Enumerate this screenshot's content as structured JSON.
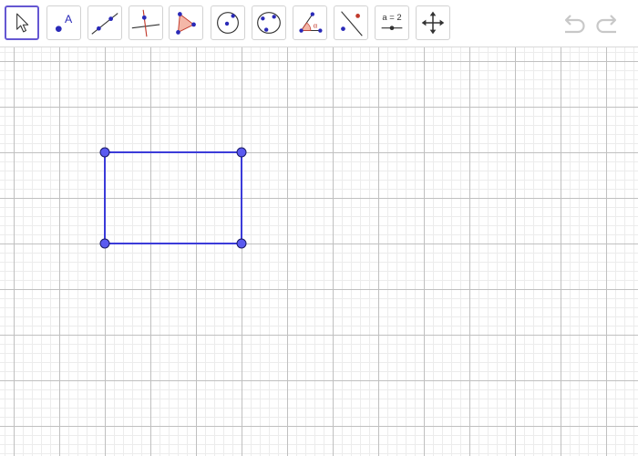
{
  "toolbar": {
    "tools": [
      {
        "id": "move",
        "icon": "move-cursor-icon",
        "selected": true
      },
      {
        "id": "point",
        "icon": "point-icon",
        "label": "A"
      },
      {
        "id": "line",
        "icon": "line-through-two-points-icon"
      },
      {
        "id": "perpendicular",
        "icon": "perpendicular-line-icon"
      },
      {
        "id": "polygon",
        "icon": "polygon-icon"
      },
      {
        "id": "circle",
        "icon": "circle-center-point-icon"
      },
      {
        "id": "conic",
        "icon": "circle-through-three-points-icon"
      },
      {
        "id": "angle",
        "icon": "angle-icon",
        "label": "α"
      },
      {
        "id": "reflect",
        "icon": "reflect-about-line-icon"
      },
      {
        "id": "slider",
        "icon": "slider-icon",
        "label": "a = 2"
      },
      {
        "id": "move-graphics",
        "icon": "move-graphics-view-icon"
      }
    ],
    "history": {
      "undo_icon": "undo-icon",
      "redo_icon": "redo-icon"
    }
  },
  "colors": {
    "selected_border": "#6557d2",
    "polygon_stroke": "#3b3bd9",
    "point_fill": "#5a5af0",
    "point_stroke": "#1a1a66",
    "grid_major": "#c0c0c0",
    "grid_minor": "#ececec"
  },
  "canvas": {
    "grid": true,
    "polygon": {
      "type": "rectangle",
      "vertices": [
        [
          0,
          0
        ],
        [
          3,
          0
        ],
        [
          3,
          2
        ],
        [
          0,
          2
        ]
      ]
    }
  }
}
